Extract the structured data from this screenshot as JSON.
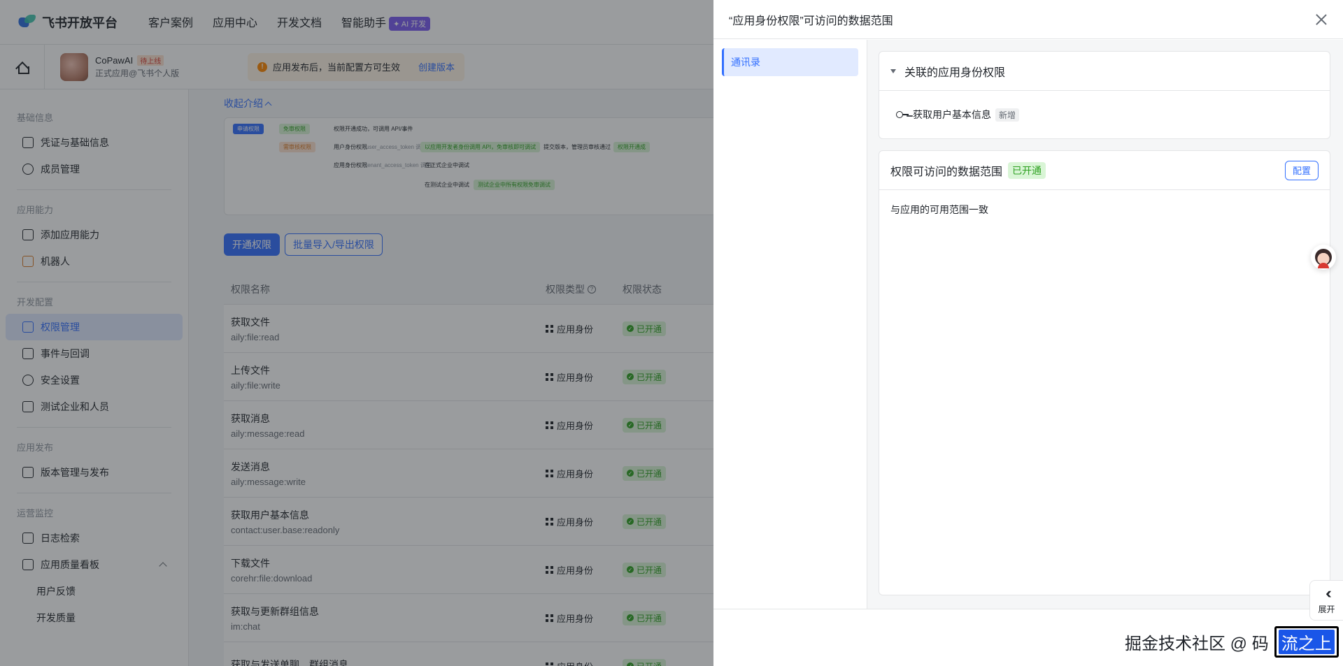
{
  "colors": {
    "accent": "#3370ff",
    "success": "#2ea121",
    "warning": "#ff8800"
  },
  "topnav": {
    "brand": "飞书开放平台",
    "links": [
      "客户案例",
      "应用中心",
      "开发文档",
      "智能助手"
    ],
    "ai_badge": "✦ AI 开发"
  },
  "subheader": {
    "app_name": "CoPawAI",
    "app_status": "待上线",
    "app_sub": "正式应用@飞书个人版",
    "notice": "应用发布后，当前配置方可生效",
    "notice_link": "创建版本"
  },
  "sidebar": {
    "groups": [
      {
        "title": "基础信息",
        "items": [
          {
            "label": "凭证与基础信息",
            "icon": "id-card-icon"
          },
          {
            "label": "成员管理",
            "icon": "user-add-icon"
          }
        ]
      },
      {
        "title": "应用能力",
        "items": [
          {
            "label": "添加应用能力",
            "icon": "apps-add-icon"
          },
          {
            "label": "机器人",
            "icon": "robot-icon"
          }
        ]
      },
      {
        "title": "开发配置",
        "items": [
          {
            "label": "权限管理",
            "icon": "lock-icon"
          },
          {
            "label": "事件与回调",
            "icon": "event-icon"
          },
          {
            "label": "安全设置",
            "icon": "shield-icon"
          },
          {
            "label": "测试企业和人员",
            "icon": "test-icon"
          }
        ]
      },
      {
        "title": "应用发布",
        "items": [
          {
            "label": "版本管理与发布",
            "icon": "publish-icon"
          }
        ]
      },
      {
        "title": "运营监控",
        "items": [
          {
            "label": "日志检索",
            "icon": "log-icon"
          },
          {
            "label": "应用质量看板",
            "icon": "chart-icon"
          },
          {
            "label": "用户反馈"
          },
          {
            "label": "开发质量"
          }
        ]
      }
    ]
  },
  "main": {
    "collapse_label": "收起介绍",
    "flow": {
      "apply": "申请权限",
      "free": "免审权限",
      "free_result": "权限开通成功，可调用 API/事件",
      "review": "需审核权限",
      "user_token": "用户身份权限",
      "user_token_code": "user_access_token 调用",
      "user_token_step": "以应用开发者身份调用 API，免审核即可调试",
      "submit": "提交版本，管理员审核通过",
      "result2": "权限开通成",
      "tenant_token": "应用身份权限",
      "tenant_token_code": "tenant_access_token 调用",
      "formal": "在正式企业中调试",
      "test": "在测试企业中调试",
      "test_result": "测试企业中所有权限免审调试"
    },
    "btn_open": "开通权限",
    "btn_batch": "批量导入/导出权限",
    "table": {
      "headers": {
        "name": "权限名称",
        "type": "权限类型",
        "status": "权限状态"
      },
      "rows": [
        {
          "title": "获取文件",
          "code": "aily:file:read",
          "type": "应用身份",
          "status": "已开通"
        },
        {
          "title": "上传文件",
          "code": "aily:file:write",
          "type": "应用身份",
          "status": "已开通"
        },
        {
          "title": "获取消息",
          "code": "aily:message:read",
          "type": "应用身份",
          "status": "已开通"
        },
        {
          "title": "发送消息",
          "code": "aily:message:write",
          "type": "应用身份",
          "status": "已开通"
        },
        {
          "title": "获取用户基本信息",
          "code": "contact:user.base:readonly",
          "type": "应用身份",
          "status": "已开通"
        },
        {
          "title": "下载文件",
          "code": "corehr:file:download",
          "type": "应用身份",
          "status": "已开通"
        },
        {
          "title": "获取与更新群组信息",
          "code": "im:chat",
          "type": "应用身份",
          "status": "已开通"
        },
        {
          "title": "获取与发送单聊、群组消息",
          "code": "",
          "type": "应用身份",
          "status": "已开通"
        }
      ]
    }
  },
  "drawer": {
    "title": "“应用身份权限”可访问的数据范围",
    "nav_item": "通讯录",
    "card1": {
      "title": "关联的应用身份权限",
      "item": "获取用户基本信息",
      "item_tag": "新增"
    },
    "card2": {
      "title": "权限可访问的数据范围",
      "status": "已开通",
      "config_btn": "配置",
      "desc": "与应用的可用范围一致"
    }
  },
  "float": {
    "expand_label": "展开"
  },
  "watermark": {
    "text": "掘金技术社区 @ 码",
    "boxed": "流之上"
  }
}
